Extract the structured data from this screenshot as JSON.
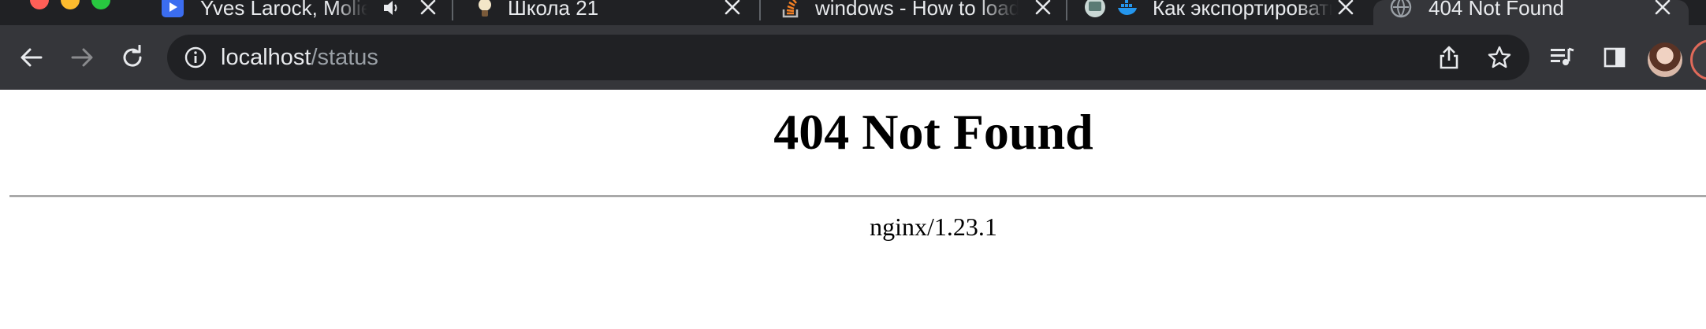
{
  "browser": {
    "tabs": [
      {
        "title": "Yves Larock, Molie",
        "favicon": "media-play-icon",
        "audio": "speaker-icon",
        "active": false
      },
      {
        "title": "Школа 21",
        "favicon": "school-bulb-icon",
        "active": false
      },
      {
        "title": "windows - How to load",
        "favicon": "stackoverflow-icon",
        "active": false
      },
      {
        "title": "Как экспортировать",
        "favicon": "docker-icon",
        "active": false
      },
      {
        "title": "404 Not Found",
        "favicon": "globe-icon",
        "active": true
      }
    ],
    "address_bar": {
      "host": "localhost",
      "path": "/status"
    }
  },
  "page": {
    "heading": "404 Not Found",
    "server_signature": "nginx/1.23.1"
  },
  "colors": {
    "tabstrip_bg": "#202124",
    "toolbar_bg": "#35363a",
    "omnibox_bg": "#202124",
    "text_light": "#e8eaed",
    "text_dim": "#9aa0a6",
    "page_bg": "#ffffff"
  }
}
